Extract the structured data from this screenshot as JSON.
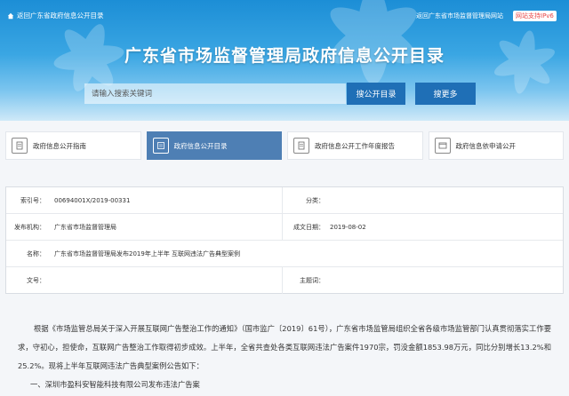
{
  "topbar": {
    "home_link": "返回广东省政府信息公开目录",
    "site_link": "返回广东省市场监督管理局网站",
    "ipv6_badge": "网站支持IPv6"
  },
  "banner": {
    "title": "广东省市场监督管理局政府信息公开目录"
  },
  "search": {
    "placeholder": "请输入搜索关键词",
    "search_button": "搜公开目录",
    "more_button": "搜更多"
  },
  "tabs": [
    {
      "label": "政府信息公开指南",
      "icon": "document-icon",
      "active": false
    },
    {
      "label": "政府信息公开目录",
      "icon": "list-icon",
      "active": true
    },
    {
      "label": "政府信息公开工作年度报告",
      "icon": "document-icon",
      "active": false
    },
    {
      "label": "政府信息依申请公开",
      "icon": "window-icon",
      "active": false
    }
  ],
  "info": {
    "index_label": "索引号：",
    "index_value": "00694001X/2019-00331",
    "category_label": "分类：",
    "category_value": "",
    "publisher_label": "发布机构：",
    "publisher_value": "广东省市场监督管理局",
    "date_label": "成文日期：",
    "date_value": "2019-08-02",
    "name_label": "名称：",
    "name_value": "广东省市场监督管理局发布2019年上半年 互联网违法广告典型案例",
    "docno_label": "文号：",
    "docno_value": "",
    "subject_label": "主题词：",
    "subject_value": ""
  },
  "article": {
    "paragraph_1": "根据《市场监管总局关于深入开展互联网广告整治工作的通知》（国市监广〔2019〕61号），广东省市场监管局组织全省各级市场监管部门认真贯彻落实工作要求，守初心，担使命，互联网广告整治工作取得初步成效。上半年，全省共查处各类互联网违法广告案件1970宗，罚没金额1853.98万元，同比分别增长13.2%和25.2%。现将上半年互联网违法广告典型案例公告如下：",
    "subhead_1": "一、深圳市盈科安智能科技有限公司发布违法广告案"
  },
  "colors": {
    "banner_top": "#1c8ed6",
    "button_blue": "#1f6fb6",
    "active_tab": "#4e7fb4",
    "ipv6_text": "#e84a4a"
  }
}
